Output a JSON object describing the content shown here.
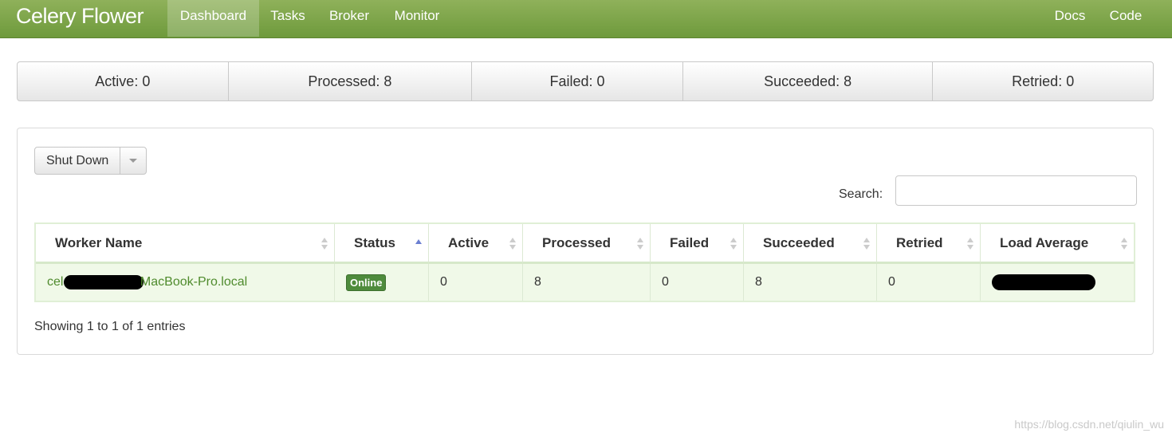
{
  "app": {
    "brand": "Celery Flower",
    "nav": [
      "Dashboard",
      "Tasks",
      "Broker",
      "Monitor"
    ],
    "nav_right": [
      "Docs",
      "Code"
    ],
    "accent": "#7aa646"
  },
  "stats": {
    "active": "Active: 0",
    "processed": "Processed: 8",
    "failed": "Failed: 0",
    "succeeded": "Succeeded: 8",
    "retried": "Retried: 0"
  },
  "toolbar": {
    "shutdown_label": "Shut Down",
    "search_label": "Search:",
    "search_value": ""
  },
  "table": {
    "columns": [
      "Worker Name",
      "Status",
      "Active",
      "Processed",
      "Failed",
      "Succeeded",
      "Retried",
      "Load Average"
    ],
    "rows": [
      {
        "worker_prefix": "celery@",
        "worker_suffix": "MacBook-Pro.local",
        "status": "Online",
        "active": "0",
        "processed": "8",
        "failed": "0",
        "succeeded": "8",
        "retried": "0"
      }
    ],
    "info": "Showing 1 to 1 of 1 entries"
  },
  "watermark": "https://blog.csdn.net/qiulin_wu"
}
